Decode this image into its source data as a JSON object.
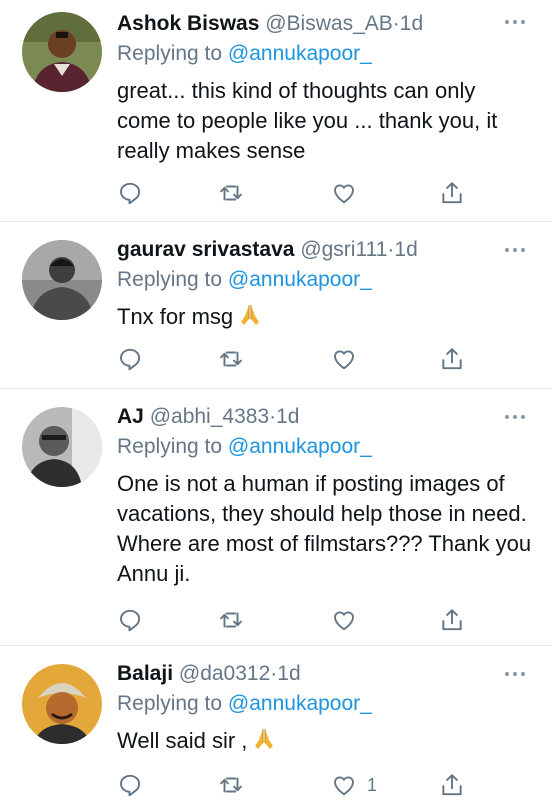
{
  "colors": {
    "text": "#0f1419",
    "secondary": "#657786",
    "link": "#1b95e0",
    "divider": "#e6ecf0"
  },
  "tweets": [
    {
      "name": "Ashok Biswas",
      "handle": "@Biswas_AB",
      "dot": "·",
      "time": "1d",
      "replying_prefix": "Replying to ",
      "replying_to": "@annukapoor_",
      "text": "great... this kind of thoughts can only come to people like you ... thank you, it really makes sense",
      "emoji": "",
      "like_count": ""
    },
    {
      "name": "gaurav srivastava",
      "handle": "@gsri111",
      "dot": "·",
      "time": "1d",
      "replying_prefix": "Replying to ",
      "replying_to": "@annukapoor_",
      "text": "Tnx for msg",
      "emoji": "folded-hands",
      "like_count": ""
    },
    {
      "name": "AJ",
      "handle": "@abhi_4383",
      "dot": "·",
      "time": "1d",
      "replying_prefix": "Replying to ",
      "replying_to": "@annukapoor_",
      "text": "One is not a human if posting images of vacations, they should help those in need. Where are most of filmstars??? Thank you Annu ji.",
      "emoji": "",
      "like_count": ""
    },
    {
      "name": "Balaji",
      "handle": "@da0312",
      "dot": "·",
      "time": "1d",
      "replying_prefix": "Replying to ",
      "replying_to": "@annukapoor_",
      "text": "Well said sir ,",
      "emoji": "folded-hands",
      "like_count": "1"
    }
  ]
}
